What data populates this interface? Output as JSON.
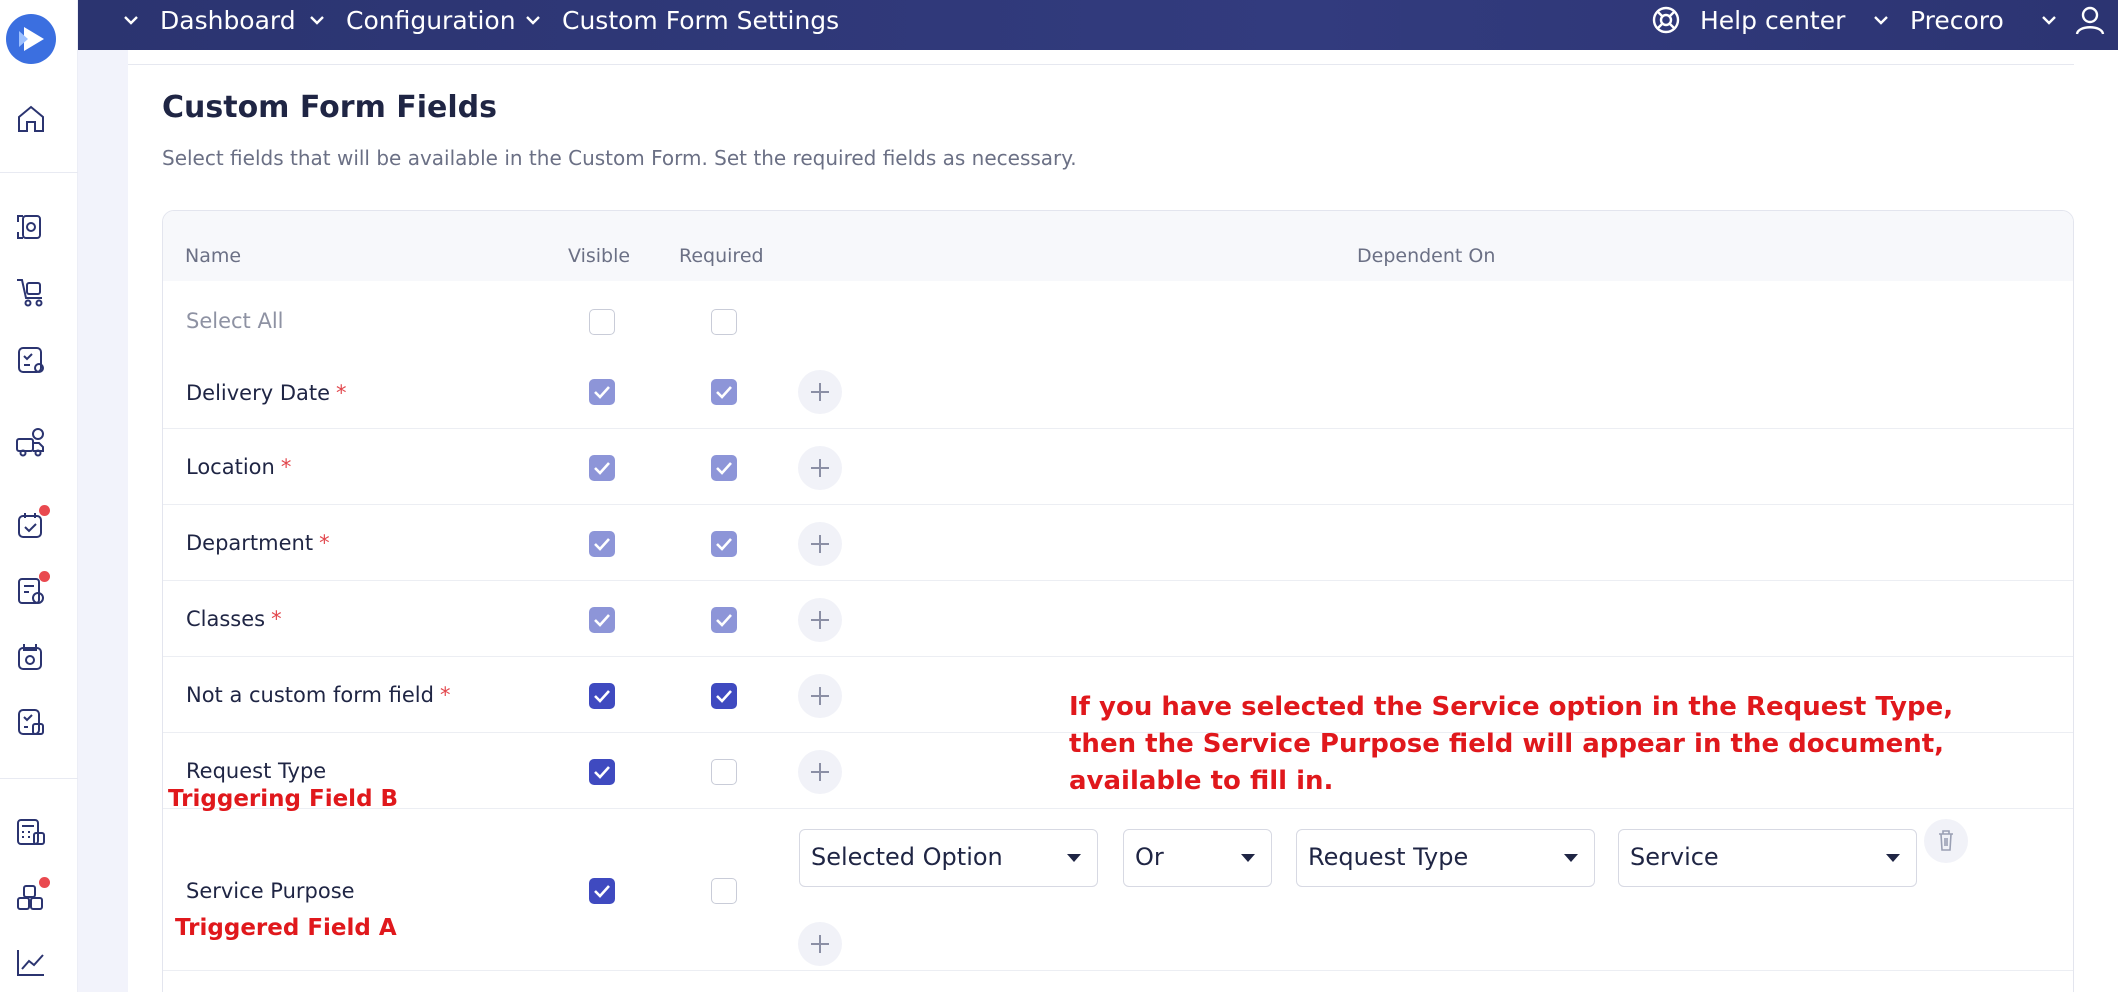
{
  "topbar": {
    "breadcrumbs": [
      "Dashboard",
      "Configuration",
      "Custom Form Settings"
    ],
    "help_center": "Help center",
    "company": "Precoro"
  },
  "page": {
    "title": "Custom Form Fields",
    "subtitle": "Select fields that will be available in the Custom Form. Set the required fields as necessary."
  },
  "table": {
    "headers": {
      "name": "Name",
      "visible": "Visible",
      "required": "Required",
      "dependent_on": "Dependent On"
    },
    "select_all": "Select All",
    "rows": [
      {
        "name": "Delivery Date",
        "required_mark": "*",
        "visible": true,
        "required": true
      },
      {
        "name": "Location",
        "required_mark": "*",
        "visible": true,
        "required": true
      },
      {
        "name": "Department",
        "required_mark": "*",
        "visible": true,
        "required": true
      },
      {
        "name": "Classes",
        "required_mark": "*",
        "visible": true,
        "required": true
      },
      {
        "name": "Not a custom form field",
        "required_mark": "*",
        "visible": true,
        "required": true
      },
      {
        "name": "Request Type",
        "visible": true,
        "required": false
      },
      {
        "name": "Service Purpose",
        "visible": true,
        "required": false
      }
    ],
    "dependency": {
      "condition": "Selected Option",
      "operator": "Or",
      "field": "Request Type",
      "value": "Service"
    }
  },
  "annotations": {
    "triggering": "Triggering Field B",
    "triggered": "Triggered Field A",
    "note_line1": "If you have selected the Service option in the Request Type,",
    "note_line2": "then the Service Purpose field will appear in the document,",
    "note_line3": "available to fill in."
  },
  "colors": {
    "topbar": "#2f3878",
    "checkbox_checked": "#3f4ac0",
    "checkbox_checked_disabled": "#8d95d8",
    "required_star": "#e2474d",
    "annotation": "#e0181c",
    "notification_dot": "#e9494f"
  }
}
